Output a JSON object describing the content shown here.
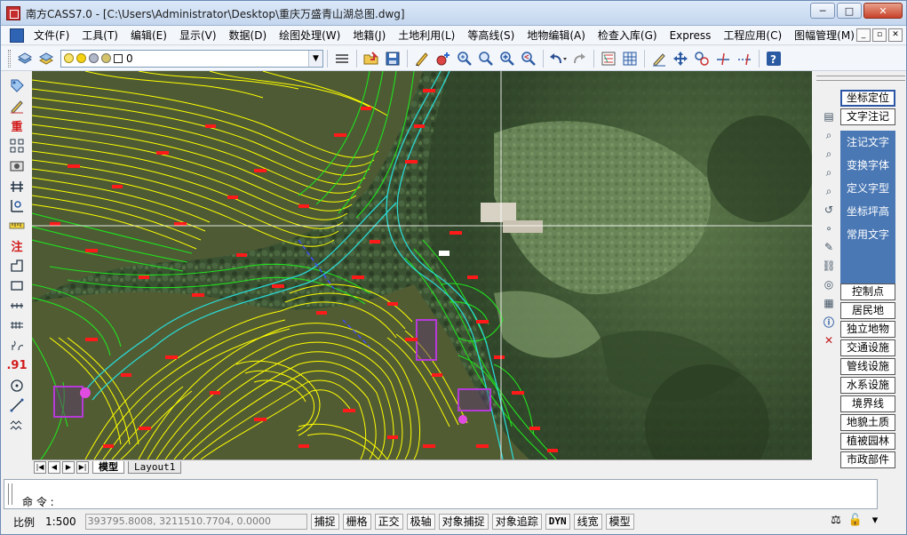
{
  "window": {
    "title": "南方CASS7.0 - [C:\\Users\\Administrator\\Desktop\\重庆万盛青山湖总图.dwg]",
    "controls": {
      "minimize": "─",
      "maximize": "□",
      "close": "✕"
    }
  },
  "menu": {
    "items": [
      "文件(F)",
      "工具(T)",
      "编辑(E)",
      "显示(V)",
      "数据(D)",
      "绘图处理(W)",
      "地籍(J)",
      "土地利用(L)",
      "等高线(S)",
      "地物编辑(A)",
      "检查入库(G)",
      "Express",
      "工程应用(C)",
      "图幅管理(M)"
    ],
    "mdi_controls": [
      "_",
      "▫",
      "✕"
    ]
  },
  "toolbar": {
    "layer_value": "0",
    "colors": {
      "bulb": "#f2d11a",
      "sun": "#f5d312",
      "swatch": "#ffffff"
    }
  },
  "left_toolbar": {
    "labels": {
      "zhong": "重",
      "zhu": "注",
      "elev": ".91"
    }
  },
  "layout_tabs": {
    "model": "模型",
    "layout1": "Layout1"
  },
  "right_panel": {
    "buttons": {
      "coord_locate": "坐标定位",
      "text_note": "文字注记",
      "control_point": "控制点",
      "residence": "居民地",
      "independent": "独立地物",
      "transport": "交通设施",
      "pipeline": "管线设施",
      "water": "水系设施",
      "boundary": "境界线",
      "landform": "地貌土质",
      "vegetation": "植被园林",
      "municipal": "市政部件"
    },
    "submenu": [
      "注记文字",
      "变换字体",
      "定义字型",
      "坐标坪高",
      "常用文字"
    ]
  },
  "command": {
    "prompt": "命 令 :"
  },
  "status": {
    "scale_label": "比例",
    "scale_value": "1:500",
    "coords": "393795.8008,  3211510.7704,  0.0000",
    "toggles": [
      "捕捉",
      "栅格",
      "正交",
      "极轴",
      "对象捕捉",
      "对象追踪",
      "DYN",
      "线宽",
      "模型"
    ]
  },
  "colors": {
    "contour_main": "#ffff00",
    "contour_green": "#22e01f",
    "road": "#2ad8d4",
    "building": "#a030c8",
    "label_red": "#ff1a1a"
  }
}
